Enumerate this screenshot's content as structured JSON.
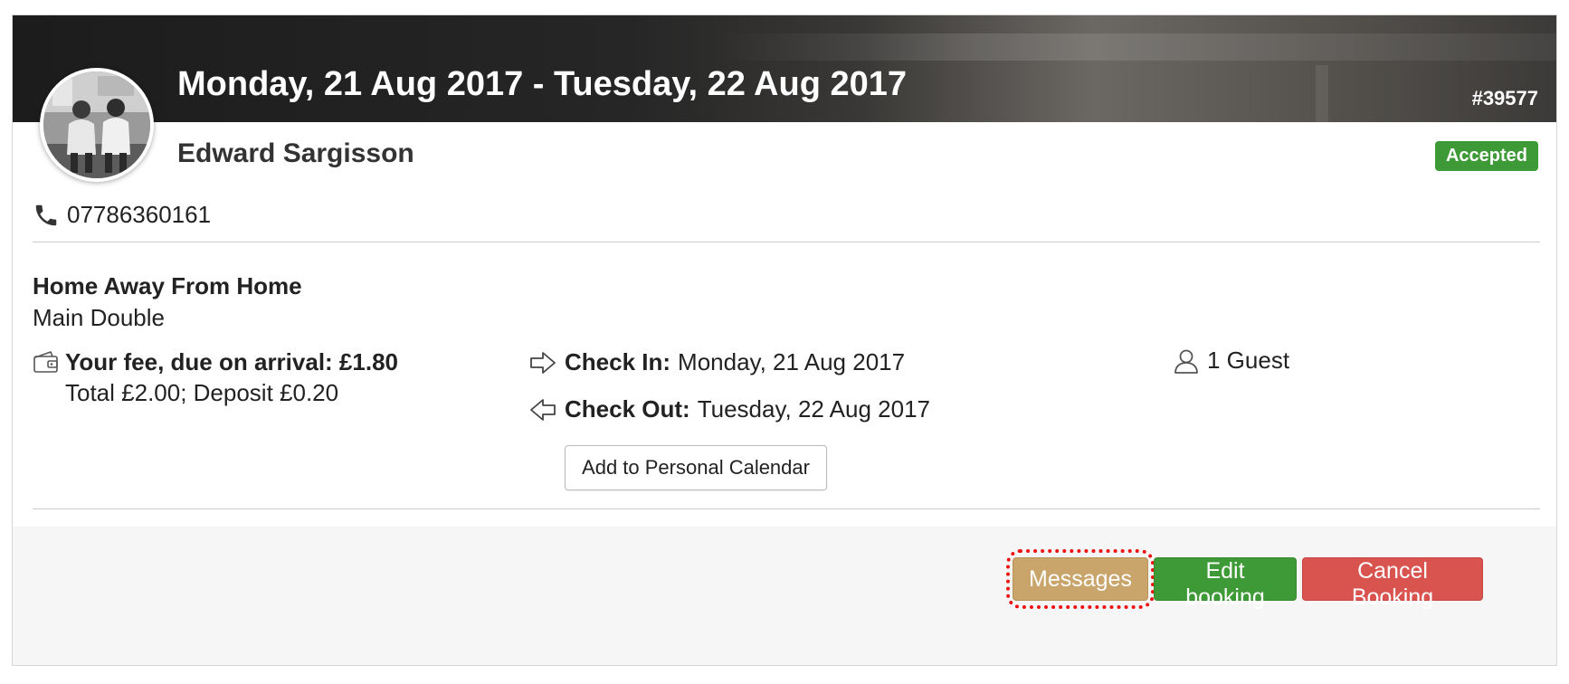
{
  "booking": {
    "date_range": "Monday, 21 Aug 2017 - Tuesday, 22 Aug 2017",
    "reference": "#39577",
    "guest_name": "Edward Sargisson",
    "status": "Accepted",
    "phone": "07786360161",
    "property_name": "Home Away From Home",
    "room_name": "Main Double",
    "fee_line": "Your fee, due on arrival: £1.80",
    "total_line": "Total £2.00; Deposit £0.20",
    "check_in_label": "Check In:",
    "check_in_value": "Monday, 21 Aug 2017",
    "check_out_label": "Check Out:",
    "check_out_value": "Tuesday, 22 Aug 2017",
    "add_calendar_label": "Add to Personal Calendar",
    "guests": "1 Guest"
  },
  "actions": {
    "messages_label": "Messages",
    "edit_label": "Edit booking",
    "cancel_label": "Cancel Booking"
  },
  "colors": {
    "accepted": "#3e9a36",
    "messages": "#c9a46b",
    "edit": "#3e9a36",
    "cancel": "#d9534f",
    "highlight_ring": "#ee1111"
  },
  "icons": {
    "phone": "phone-icon",
    "wallet": "wallet-icon",
    "check_in": "arrow-right-icon",
    "check_out": "arrow-left-icon",
    "guest": "user-icon"
  }
}
